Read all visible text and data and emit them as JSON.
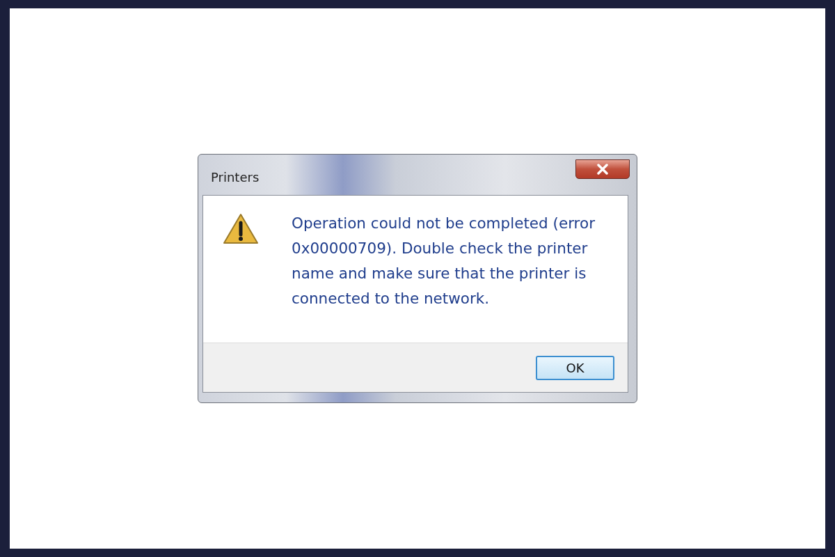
{
  "window": {
    "title": "Printers"
  },
  "message": "Operation could not be completed (error 0x00000709). Double check the printer name and make sure that the printer is connected to the network.",
  "buttons": [
    {
      "label": "OK",
      "selected": true
    }
  ]
}
